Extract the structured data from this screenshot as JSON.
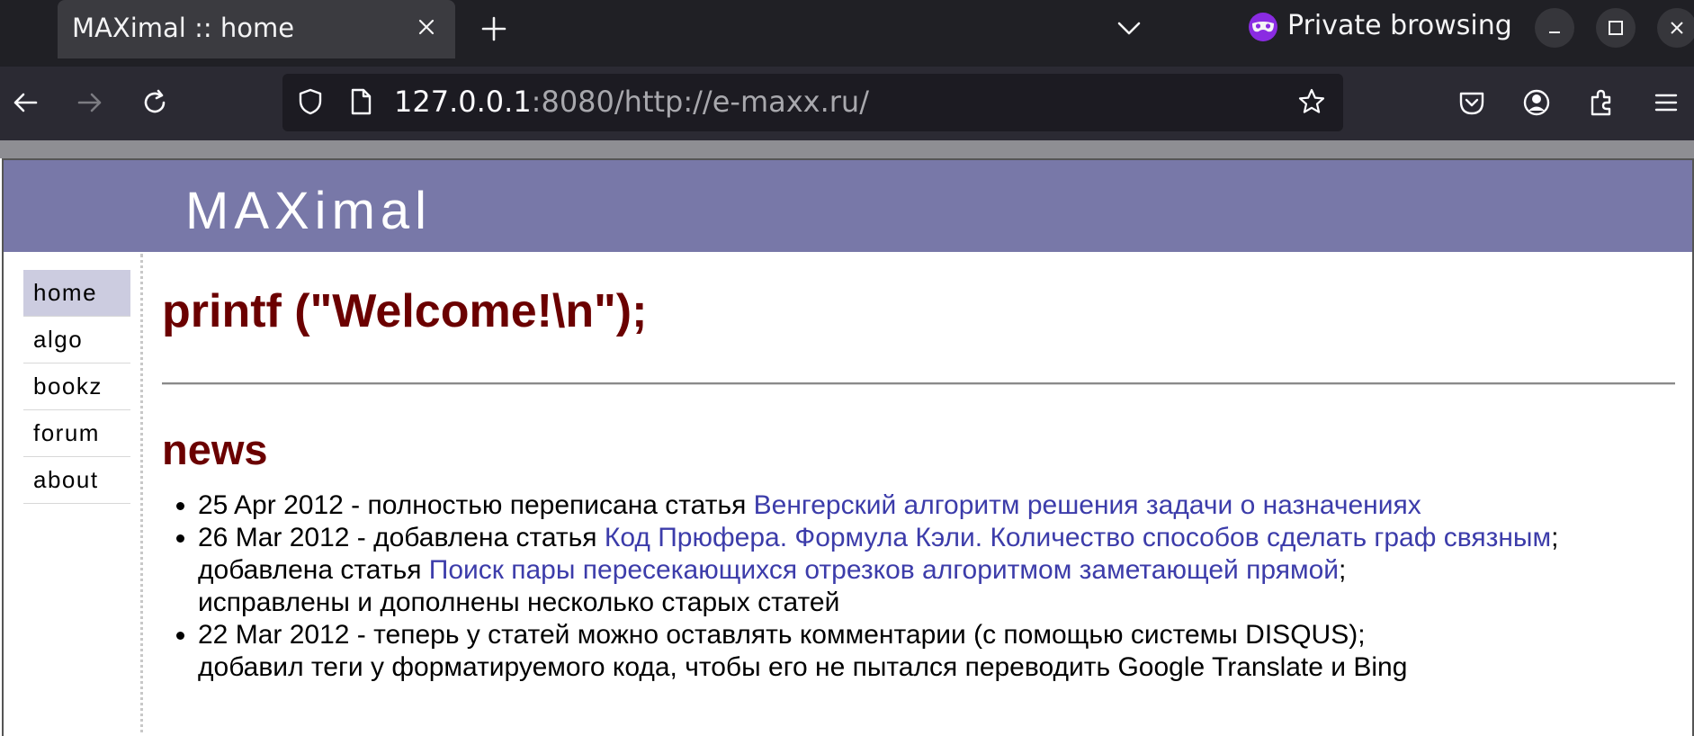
{
  "browser": {
    "tab_title": "MAXimal :: home",
    "private_label": "Private browsing",
    "url_host": "127.0.0.1",
    "url_rest": ":8080/http://e-maxx.ru/"
  },
  "site": {
    "title": "MAXimal",
    "menu": [
      "home",
      "algo",
      "bookz",
      "forum",
      "about"
    ],
    "active_menu": "home"
  },
  "main": {
    "welcome": "printf (\"Welcome!\\n\");",
    "news_heading": "news",
    "news": [
      {
        "date": "25 Apr 2012",
        "text1": " - полностью переписана статья ",
        "link1": "Венгерский алгоритм решения задачи о назначениях"
      },
      {
        "date": "26 Mar 2012",
        "text1": " - добавлена статья ",
        "link1": "Код Прюфера. Формула Кэли. Количество способов сделать граф связным",
        "after1": ";",
        "text2": "добавлена статья ",
        "link2": "Поиск пары пересекающихся отрезков алгоритмом заметающей прямой",
        "after2": ";",
        "text3": "исправлены и дополнены несколько старых статей"
      },
      {
        "date": "22 Mar 2012",
        "text1": " - теперь у статей можно оставлять комментарии (с помощью системы DISQUS);",
        "text2": "добавил теги у форматируемого кода, чтобы его не пытался переводить Google Translate и Bing"
      }
    ]
  },
  "colors": {
    "header_bg": "#7878a8",
    "heading": "#6b0000",
    "link": "#3c3caa",
    "active_menu_bg": "#cccce0",
    "private_accent": "#8a2be2"
  },
  "icons": [
    "close-icon",
    "plus-icon",
    "chevron-down-icon",
    "private-mask-icon",
    "minimize-icon",
    "maximize-icon",
    "window-close-icon",
    "back-arrow-icon",
    "forward-arrow-icon",
    "reload-icon",
    "shield-icon",
    "page-icon",
    "star-icon",
    "pocket-icon",
    "account-icon",
    "extensions-icon",
    "hamburger-menu-icon"
  ]
}
